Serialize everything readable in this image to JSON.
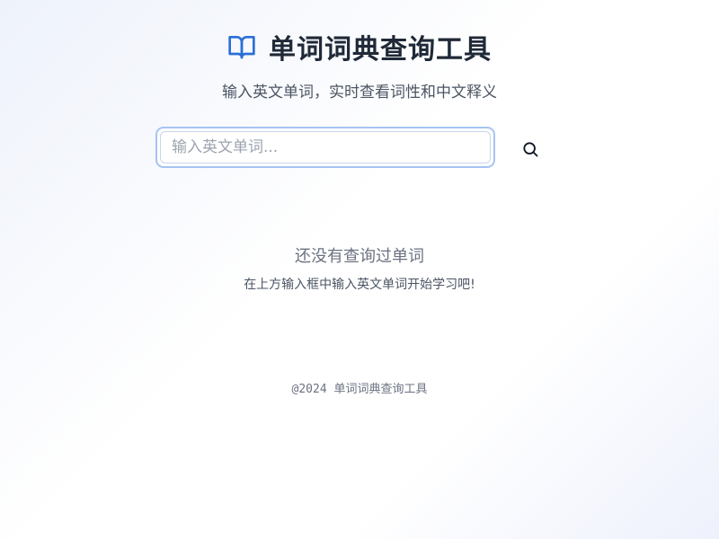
{
  "header": {
    "icon": "book-open-icon",
    "title": "单词词典查询工具",
    "subtitle": "输入英文单词，实时查看词性和中文释义"
  },
  "search": {
    "placeholder": "输入英文单词...",
    "value": "",
    "button_icon": "search-icon"
  },
  "empty_state": {
    "title": "还没有查询过单词",
    "hint": "在上方输入框中输入英文单词开始学习吧!"
  },
  "footer": {
    "text": "@2024 单词词典查询工具"
  },
  "colors": {
    "accent": "#2b6fd6",
    "text_primary": "#1f2937",
    "text_secondary": "#4b5563",
    "text_muted": "#6b7280",
    "input_border": "#a5c4f2"
  }
}
